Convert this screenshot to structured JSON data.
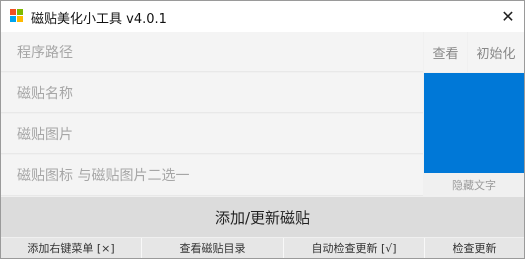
{
  "window": {
    "title": "磁贴美化小工具 v4.0.1",
    "icon": "windows-logo-icon",
    "close_glyph": "✕"
  },
  "fields": {
    "path_placeholder": "程序路径",
    "name_placeholder": "磁贴名称",
    "image_placeholder": "磁贴图片",
    "icon_placeholder": "磁贴图标  与磁贴图片二选一"
  },
  "buttons": {
    "view": "查看",
    "init": "初始化",
    "hide_text": "隐藏文字",
    "add_update": "添加/更新磁贴"
  },
  "bottom": {
    "add_menu": "添加右键菜单 [×]",
    "view_dir": "查看磁贴目录",
    "auto_check": "自动检查更新 [√]",
    "check_update": "检查更新"
  },
  "colors": {
    "tile_preview": "#0078d7",
    "main_button": "#dcdcdc",
    "placeholder_text": "#a6a6a6"
  }
}
